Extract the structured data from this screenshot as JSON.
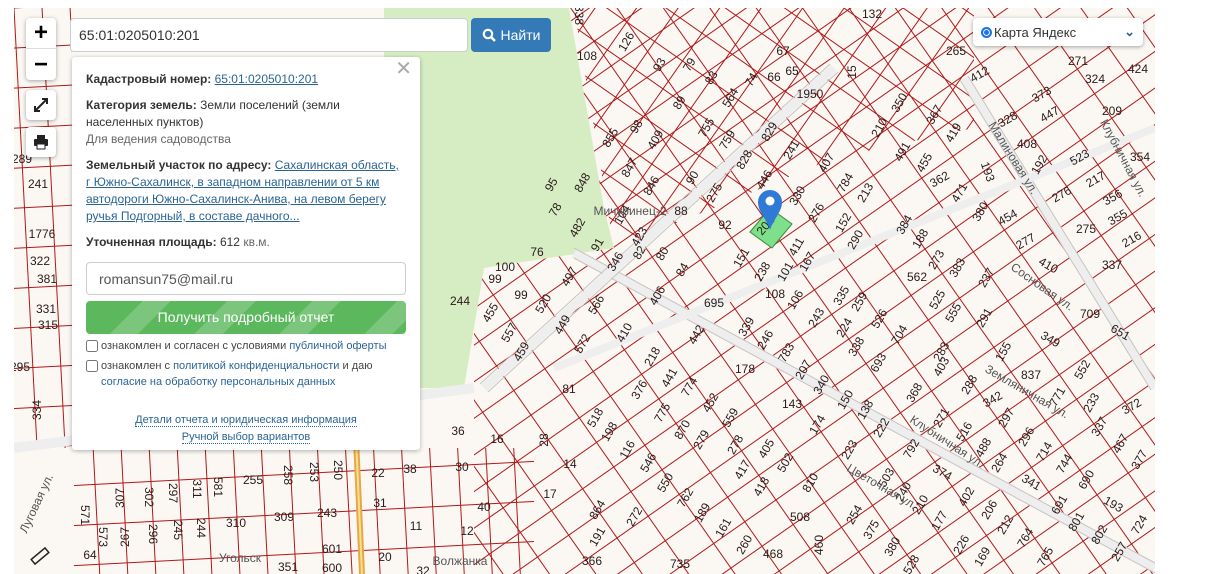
{
  "search": {
    "value": "65:01:0205010:201",
    "button_label": "Найти"
  },
  "controls": {
    "zoom_in": "+",
    "zoom_out": "−"
  },
  "layer_selector": {
    "selected": "Карта Яндекс"
  },
  "panel": {
    "cadastral_label": "Кадастровый номер:",
    "cadastral_value": "65:01:0205010:201",
    "category_label": "Категория земель:",
    "category_value": "Земли поселений (земли населенных пунктов)",
    "usage": "Для ведения садоводства",
    "address_label": "Земельный участок по адресу:",
    "address_value": "Сахалинская область, г Южно-Сахалинск, в западном направлении от 5 км автодороги Южно-Сахалинск-Анива, на левом берегу ручья Подгорный, в составе дачного...",
    "area_label": "Уточненная площадь:",
    "area_value": "612",
    "area_unit": "кв.м.",
    "email_value": "romansun75@mail.ru",
    "report_button": "Получить подробный отчет",
    "consent1_text": "ознакомлен и согласен с условиями ",
    "consent1_link": "публичной оферты",
    "consent2_text": "ознакомлен с ",
    "consent2_link": "политикой конфиденциальности",
    "consent2_mid": " и даю ",
    "consent2_link2": "согласие на обработку персональных данных",
    "details_link": "Детали отчета и юридическая информация",
    "manual_link": "Ручной выбор вариантов"
  },
  "map": {
    "selected_parcel": "201",
    "parcel_color": "#b01818",
    "selected_color": "#7ee08a",
    "marker_color": "#2f7ad6",
    "streets": [
      "Малиновая ул.",
      "Клубничная ул.",
      "Земляничная ул.",
      "Цветочная ул.",
      "Сосновая ул.",
      "Клубничная ул.",
      "Угольск",
      "Волжанка",
      "Луговая ул.",
      "Мичуринец-2"
    ],
    "parcels": [
      "338",
      "126",
      "132",
      "67",
      "66",
      "65",
      "1950",
      "15",
      "108",
      "93",
      "79",
      "83",
      "74",
      "564",
      "89",
      "755",
      "759",
      "829",
      "828",
      "241",
      "98",
      "409",
      "855",
      "847",
      "846",
      "90",
      "275",
      "446",
      "848",
      "88",
      "92",
      "104",
      "482",
      "78",
      "95",
      "91",
      "423",
      "346",
      "82",
      "80",
      "84",
      "76",
      "100",
      "99",
      "99",
      "497",
      "520",
      "449",
      "566",
      "406",
      "244",
      "455",
      "557",
      "459",
      "572",
      "410",
      "695",
      "442",
      "339",
      "246",
      "783",
      "178",
      "330",
      "407",
      "784",
      "276",
      "213",
      "152",
      "290",
      "384",
      "188",
      "151",
      "238",
      "101",
      "411",
      "167",
      "108",
      "106",
      "243",
      "335",
      "259",
      "224",
      "526",
      "562",
      "273",
      "383",
      "525",
      "555",
      "237",
      "291",
      "704",
      "338",
      "693",
      "283",
      "403",
      "368",
      "207",
      "340",
      "143",
      "150",
      "174",
      "138",
      "222",
      "223",
      "218",
      "441",
      "376",
      "774",
      "775",
      "452",
      "870",
      "559",
      "279",
      "278",
      "405",
      "502",
      "417",
      "418",
      "810",
      "550",
      "546",
      "116",
      "198",
      "518",
      "81",
      "28",
      "14",
      "17",
      "762",
      "189",
      "161",
      "260",
      "468",
      "508",
      "460",
      "254",
      "375",
      "380",
      "528",
      "503",
      "240",
      "210",
      "177",
      "792",
      "374",
      "402",
      "206",
      "212",
      "226",
      "169",
      "764",
      "765",
      "271",
      "288",
      "342",
      "297",
      "516",
      "488",
      "264",
      "296",
      "714",
      "341",
      "744",
      "690",
      "193",
      "691",
      "801",
      "802",
      "257",
      "724",
      "155",
      "837",
      "771",
      "552",
      "349",
      "233",
      "337",
      "372",
      "467",
      "377",
      "709",
      "651",
      "412",
      "265",
      "274",
      "271",
      "324",
      "424",
      "373",
      "447",
      "328",
      "408",
      "192",
      "523",
      "217",
      "356",
      "355",
      "216",
      "275",
      "276",
      "354",
      "209",
      "337",
      "410",
      "277",
      "454",
      "380",
      "471",
      "362",
      "455",
      "491",
      "367",
      "419",
      "193",
      "350",
      "210",
      "289",
      "241",
      "1776",
      "322",
      "381",
      "331",
      "315",
      "295",
      "334",
      "307",
      "302",
      "297",
      "311",
      "581",
      "255",
      "258",
      "253",
      "250",
      "267",
      "296",
      "245",
      "244",
      "310",
      "309",
      "243",
      "571",
      "573",
      "64",
      "601",
      "600",
      "351",
      "22",
      "38",
      "31",
      "11",
      "20",
      "32",
      "30",
      "40",
      "12",
      "36",
      "16",
      "864",
      "191",
      "272",
      "366",
      "735"
    ]
  }
}
